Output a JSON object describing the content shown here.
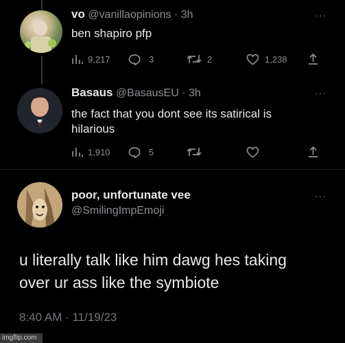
{
  "tweet1": {
    "name": "vo",
    "handle": "@vanillaopinions",
    "time": "3h",
    "text": "ben shapiro pfp",
    "views": "9,217",
    "replies": "3",
    "retweets": "2",
    "likes": "1,238"
  },
  "tweet2": {
    "name": "Basaus",
    "handle": "@BasausEU",
    "time": "3h",
    "line1": "the fact that you dont see its satirical is",
    "line2": "hilarious",
    "views": "1,910",
    "replies": "5"
  },
  "tweet3": {
    "name": "poor, unfortunate vee",
    "handle": "@SmilingImpEmoji",
    "line1": "u literally talk like him dawg hes taking",
    "line2": "over ur ass like the symbiote",
    "timestamp": "8:40 AM · 11/19/23"
  },
  "watermark": "imgflip.com",
  "icons": [
    "views-icon",
    "reply-icon",
    "retweet-icon",
    "like-icon",
    "share-icon",
    "more-icon"
  ]
}
